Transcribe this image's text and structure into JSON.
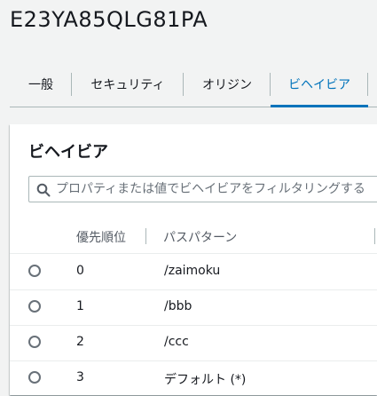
{
  "page": {
    "title": "E23YA85QLG81PA"
  },
  "tabs": [
    {
      "label": "一般",
      "active": false
    },
    {
      "label": "セキュリティ",
      "active": false
    },
    {
      "label": "オリジン",
      "active": false
    },
    {
      "label": "ビヘイビア",
      "active": true
    }
  ],
  "behaviors": {
    "title": "ビヘイビア",
    "search": {
      "placeholder": "プロパティまたは値でビヘイビアをフィルタリングする",
      "value": ""
    },
    "columns": {
      "priority": "優先順位",
      "path_pattern": "パスパターン"
    },
    "rows": [
      {
        "priority": "0",
        "path_pattern": "/zaimoku"
      },
      {
        "priority": "1",
        "path_pattern": "/bbb"
      },
      {
        "priority": "2",
        "path_pattern": "/ccc"
      },
      {
        "priority": "3",
        "path_pattern": "デフォルト (*)"
      }
    ]
  },
  "colors": {
    "accent": "#0073bb",
    "background": "#f2f3f3",
    "panel": "#ffffff",
    "text": "#16191f",
    "muted_text": "#545b64",
    "border": "#aab7b8"
  },
  "icons": {
    "search": "search-icon",
    "radio": "radio-button"
  }
}
